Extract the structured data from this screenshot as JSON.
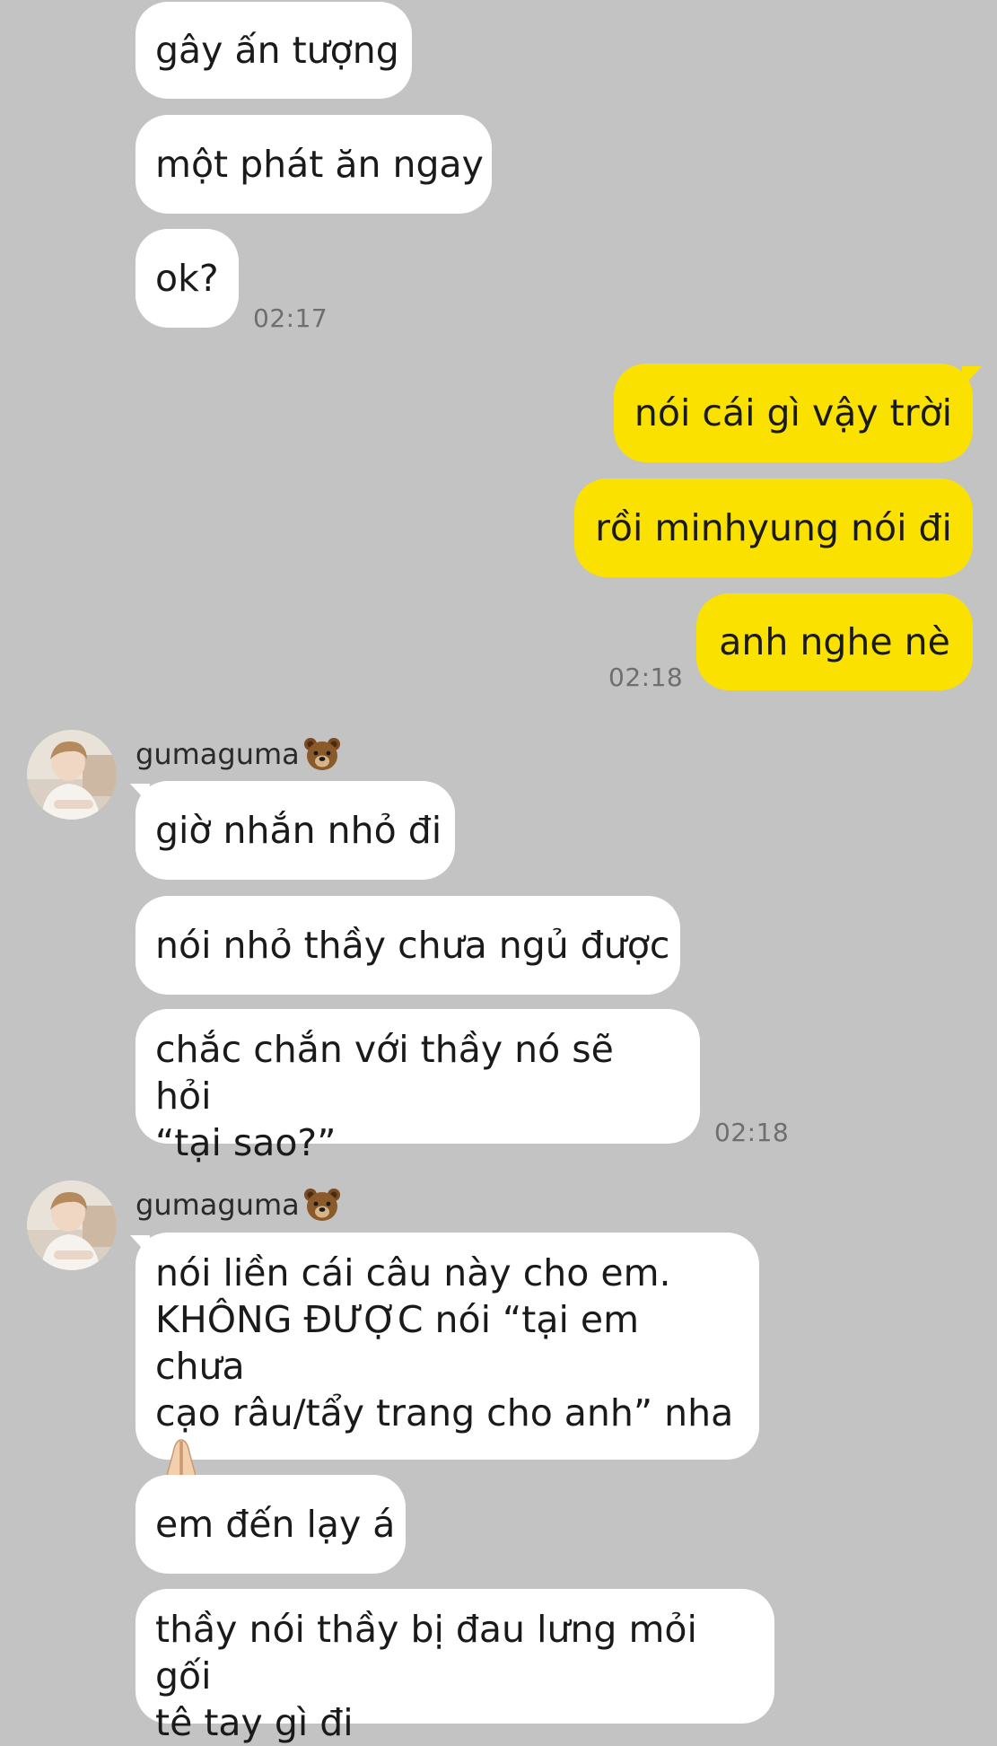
{
  "messages": {
    "m1": "gây ấn tượng",
    "m2": "một phát ăn ngay",
    "m3": "ok?",
    "t1": "02:17",
    "m4": "nói cái gì vậy trời",
    "m5": "rồi minhyung nói đi",
    "m6": "anh nghe nè",
    "t2": "02:18",
    "sender1": "gumaguma",
    "m7": "giờ nhắn nhỏ đi",
    "m8": "nói nhỏ thầy chưa ngủ được",
    "m9_line1": "chắc chắn với thầy nó sẽ hỏi",
    "m9_line2": "“tại sao?”",
    "t3": "02:18",
    "sender2": "gumaguma",
    "m10_line1": "nói liền cái câu này cho em.",
    "m10_line2": "KHÔNG ĐƯỢC nói “tại em chưa",
    "m10_line3": "cạo râu/tẩy trang cho anh” nha",
    "m11": "em đến lạy á",
    "m12_line1": "thầy nói thầy bị đau lưng mỏi gối",
    "m12_line2": "tê tay gì đi"
  },
  "icons": {
    "sender_badge": "bear-face-icon",
    "emoji": "folded-hands-icon"
  },
  "colors": {
    "background": "#c3c3c3",
    "incoming_bubble": "#ffffff",
    "outgoing_bubble": "#fae100",
    "timestamp": "#6e6e6e"
  }
}
